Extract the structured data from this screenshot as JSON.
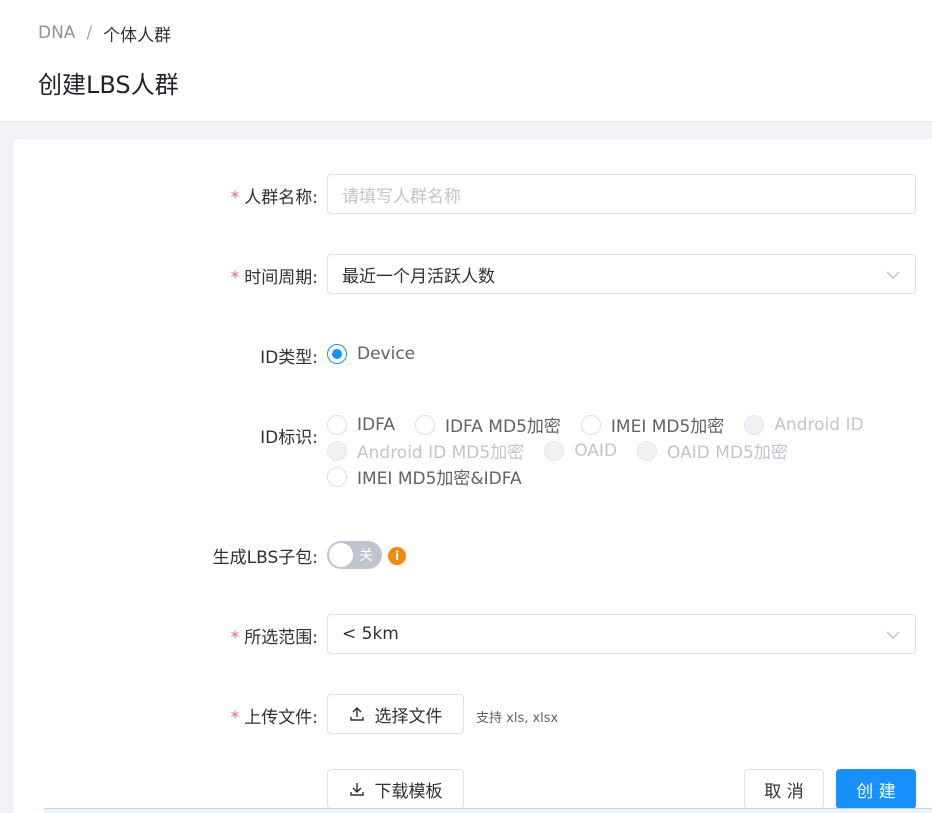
{
  "breadcrumb": {
    "root": "DNA",
    "separator": "/",
    "current": "个体人群"
  },
  "page": {
    "title": "创建LBS人群"
  },
  "form": {
    "name": {
      "label": "人群名称:",
      "placeholder": "请填写人群名称"
    },
    "period": {
      "label": "时间周期:",
      "value": "最近一个月活跃人数"
    },
    "id_type": {
      "label": "ID类型:",
      "options": [
        {
          "label": "Device",
          "checked": true
        }
      ]
    },
    "id_mark": {
      "label": "ID标识:",
      "options": [
        {
          "label": "IDFA",
          "disabled": false
        },
        {
          "label": "IDFA MD5加密",
          "disabled": false
        },
        {
          "label": "IMEI MD5加密",
          "disabled": false
        },
        {
          "label": "Android ID",
          "disabled": true
        },
        {
          "label": "Android ID MD5加密",
          "disabled": true
        },
        {
          "label": "OAID",
          "disabled": true
        },
        {
          "label": "OAID MD5加密",
          "disabled": true
        },
        {
          "label": "IMEI MD5加密&IDFA",
          "disabled": false
        }
      ]
    },
    "lbs_sub": {
      "label": "生成LBS子包:",
      "switch_text": "关",
      "on": false,
      "info": "i"
    },
    "range": {
      "label": "所选范围:",
      "value": "< 5km"
    },
    "upload": {
      "label": "上传文件:",
      "button": "选择文件",
      "hint": "支持 xls, xlsx"
    },
    "download_button": "下载模板",
    "cancel_button": "取 消",
    "create_button": "创 建"
  },
  "colors": {
    "primary": "#1890ff",
    "required": "#f56c6c",
    "warning": "#f08a0c"
  }
}
